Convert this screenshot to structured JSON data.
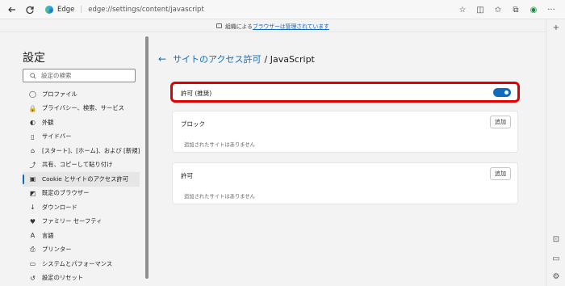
{
  "toolbar": {
    "brand": "Edge",
    "url": "edge://settings/content/javascript"
  },
  "banner": {
    "prefix": "組織による",
    "link": "ブラウザーは管理されています"
  },
  "sidebar": {
    "title": "設定",
    "search_placeholder": "設定の検索",
    "items": [
      {
        "label": "プロファイル",
        "icon": "profile-icon"
      },
      {
        "label": "プライバシー、検索、サービス",
        "icon": "lock-icon"
      },
      {
        "label": "外観",
        "icon": "appearance-icon"
      },
      {
        "label": "サイドバー",
        "icon": "sidebar-icon"
      },
      {
        "label": "[スタート]、[ホーム]、および [新規] タブ",
        "icon": "home-tab-icon"
      },
      {
        "label": "共有、コピーして貼り付け",
        "icon": "share-icon"
      },
      {
        "label": "Cookie とサイトのアクセス許可",
        "icon": "cookie-icon"
      },
      {
        "label": "既定のブラウザー",
        "icon": "default-browser-icon"
      },
      {
        "label": "ダウンロード",
        "icon": "download-icon"
      },
      {
        "label": "ファミリー セーフティ",
        "icon": "family-icon"
      },
      {
        "label": "言語",
        "icon": "language-icon"
      },
      {
        "label": "プリンター",
        "icon": "printer-icon"
      },
      {
        "label": "システムとパフォーマンス",
        "icon": "system-icon"
      },
      {
        "label": "設定のリセット",
        "icon": "reset-icon"
      }
    ],
    "active_index": 6
  },
  "main": {
    "breadcrumb_link": "サイトのアクセス許可",
    "breadcrumb_current": "/ JavaScript",
    "allow_toggle_label": "許可 (推奨)",
    "allow_toggle_on": true,
    "block_section": {
      "title": "ブロック",
      "add_label": "追加",
      "empty_text": "追加されたサイトはありません"
    },
    "allow_section": {
      "title": "許可",
      "add_label": "追加",
      "empty_text": "追加されたサイトはありません"
    }
  },
  "colors": {
    "accent": "#0f6cbd",
    "highlight_border": "#e10000"
  }
}
